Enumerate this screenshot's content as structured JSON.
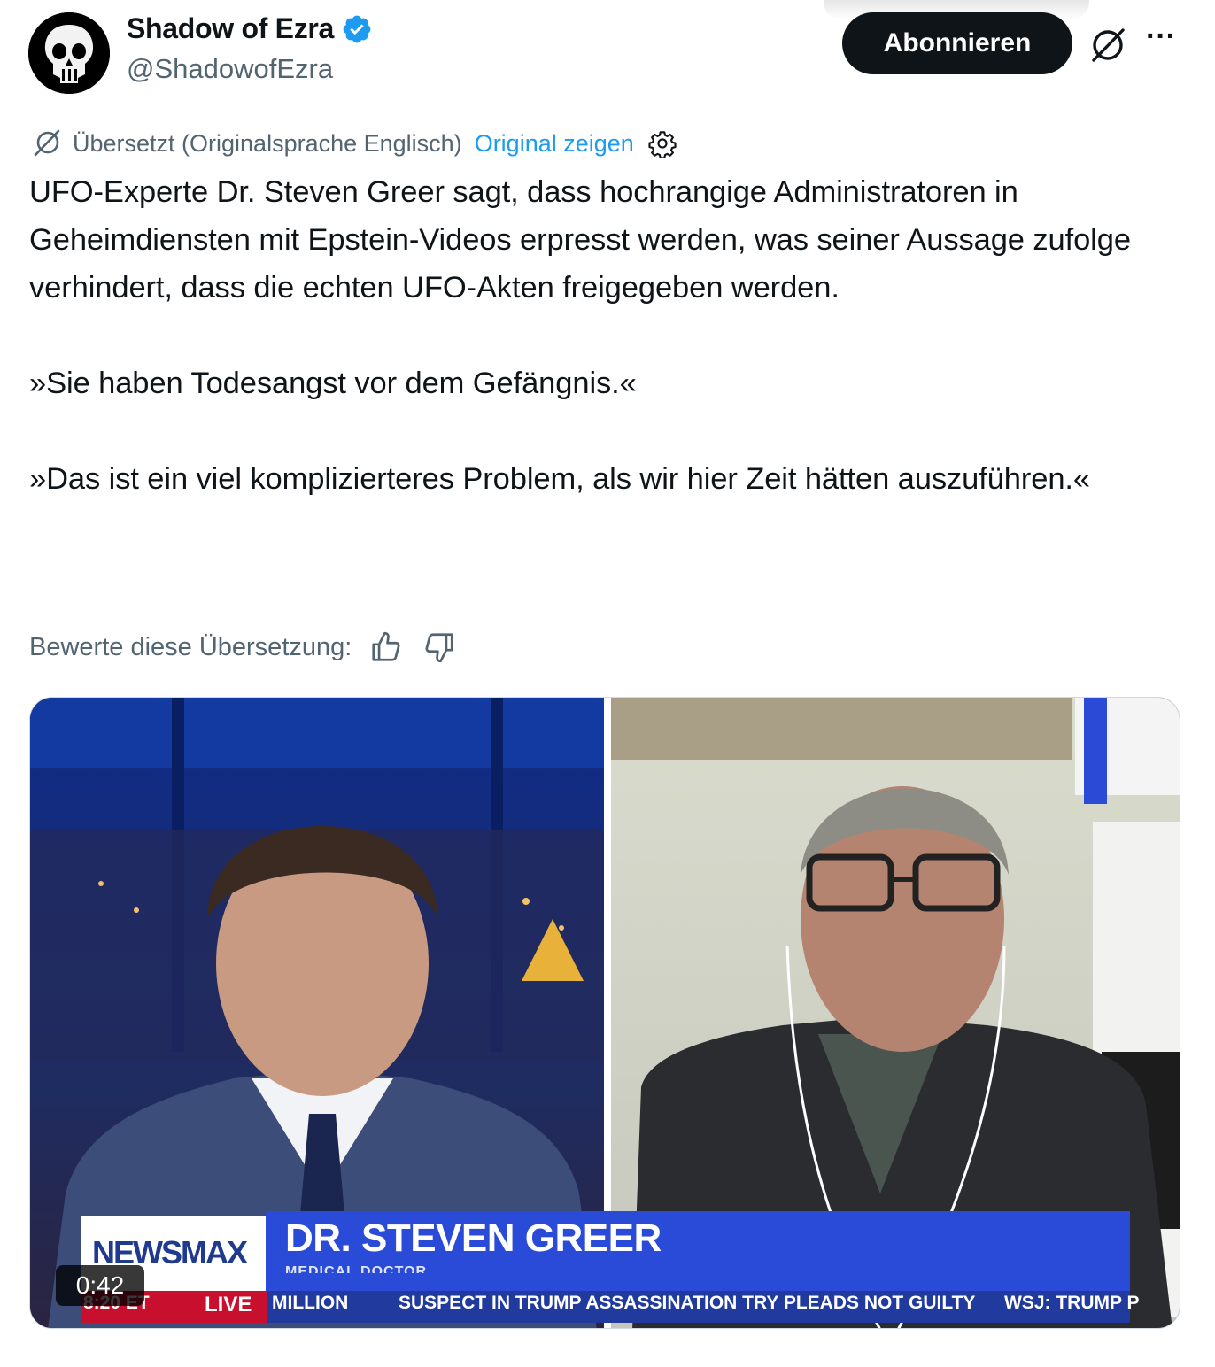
{
  "author": {
    "display_name": "Shadow of Ezra",
    "handle": "@ShadowofEzra",
    "verified": true
  },
  "actions": {
    "subscribe_label": "Abonnieren",
    "grok_icon": "grok-icon",
    "more_icon": "more-icon",
    "more_glyph": "···"
  },
  "translation": {
    "notice": "Übersetzt (Originalsprache Englisch)",
    "show_original": "Original zeigen",
    "rate_label": "Bewerte diese Übersetzung:"
  },
  "tweet": {
    "text": "UFO-Experte Dr. Steven Greer sagt, dass hochrangige Administratoren in Geheimdiensten mit Epstein-Videos erpresst werden, was seiner Aussage zufolge verhindert, dass die echten UFO-Akten freigegeben werden.\n\n»Sie haben Todesangst vor dem Gefängnis.«\n\n»Das ist ein viel komplizierteres Problem, als wir hier Zeit hätten auszuführen.«"
  },
  "video": {
    "duration": "0:42",
    "broadcast": {
      "logo": "NEWSMAX",
      "guest_name": "DR. STEVEN GREER",
      "guest_title": "MEDICAL DOCTOR",
      "ticker_time": "8:20 ET",
      "ticker_live": "LIVE",
      "ticker_million": "MILLION",
      "ticker_headline": "SUSPECT IN TRUMP ASSASSINATION TRY PLEADS NOT GUILTY",
      "ticker_next": "WSJ: TRUMP P"
    }
  },
  "colors": {
    "link": "#1d9bf0",
    "secondary_text": "#536471",
    "primary_text": "#0f1419",
    "verified_badge": "#1d9bf0",
    "chyron_blue": "#2a4bd7",
    "ticker_red": "#c8102e"
  }
}
